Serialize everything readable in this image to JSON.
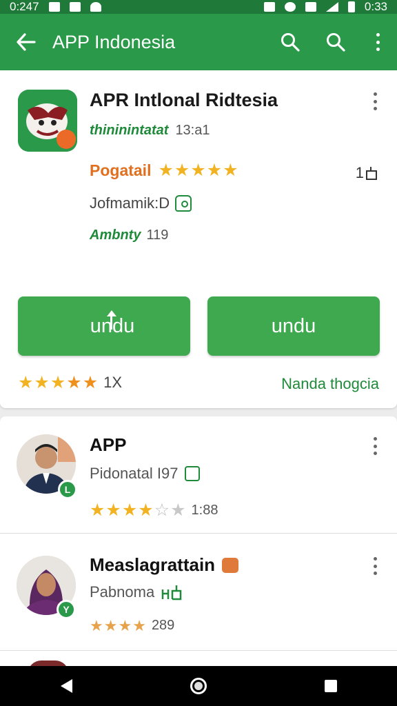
{
  "status_bar": {
    "time_left": "0:247",
    "time_right": "0:33"
  },
  "app_bar": {
    "title": "APP Indonesia",
    "back_icon": "arrow-back-icon",
    "search_icon_1": "search-icon",
    "search_icon_2": "search-icon",
    "more_icon": "more-vert-icon"
  },
  "app": {
    "title": "APR Intlonal Ridtesia",
    "developer": "thininintatat",
    "developer_meta": "13:a1",
    "rating_label": "Pogatail",
    "rating_stars": 5,
    "right_count": "1",
    "info": "Jofmamik:D",
    "age_label": "Ambnty",
    "age_value": "119",
    "button_left": "undu",
    "button_right": "undu",
    "footer_rating_stars": 5,
    "footer_count": "1X",
    "footer_link": "Nanda thogcia",
    "colors": {
      "primary": "#2a9a4a",
      "button": "#3fa94f",
      "accent_orange": "#e07020",
      "star": "#f2b322"
    }
  },
  "list": {
    "items": [
      {
        "title": "APP",
        "subtitle": "Pidonatal I97",
        "rating": 3.5,
        "count": "1:88",
        "badge": "L"
      },
      {
        "title": "Measlagrattain",
        "subtitle": "Pabnoma",
        "rating": 4.5,
        "count": "289",
        "badge": "Y"
      }
    ]
  },
  "nav_bar": {
    "back": "nav-back-icon",
    "home": "nav-home-icon",
    "recent": "nav-recent-icon"
  }
}
